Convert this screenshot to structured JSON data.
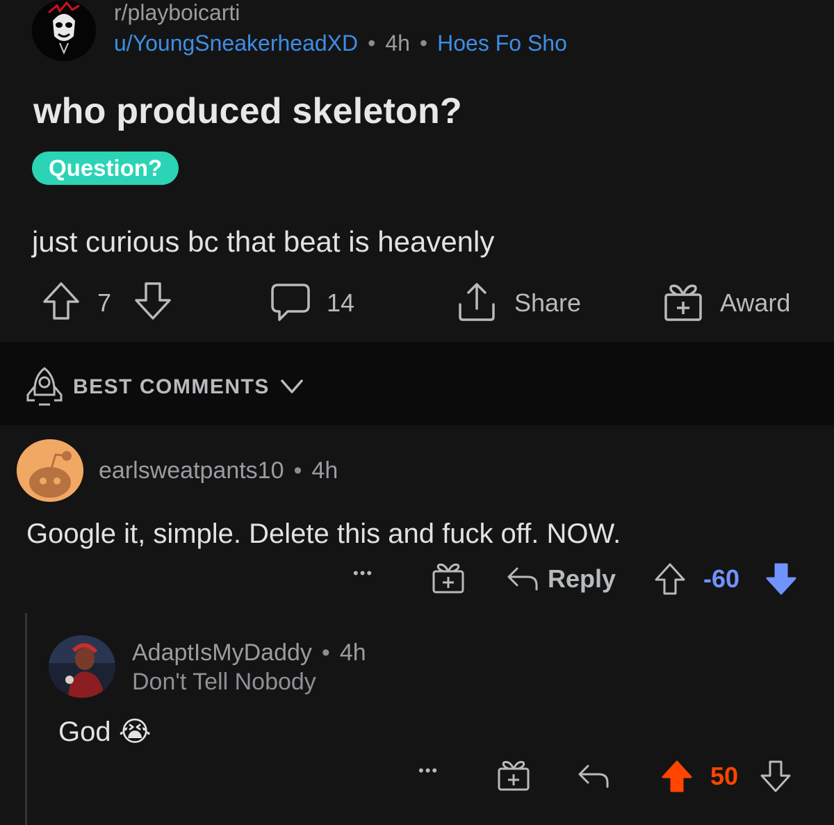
{
  "post": {
    "subreddit": "r/playboicarti",
    "author": "u/YoungSneakerheadXD",
    "separator": "•",
    "age": "4h",
    "author_flair": "Hoes Fo Sho",
    "title": "who produced skeleton?",
    "flair": "Question?",
    "body": "just curious bc that beat is heavenly",
    "score": "7",
    "comment_count": "14",
    "share_label": "Share",
    "award_label": "Award",
    "flair_color": "#2bd4b4",
    "link_color": "#3d8ee6"
  },
  "sort": {
    "label": "BEST COMMENTS",
    "icon": "rocket-icon"
  },
  "comments": [
    {
      "author": "earlsweatpants10",
      "separator": "•",
      "age": "4h",
      "body": "Google it, simple. Delete this and fuck off. NOW.",
      "more_label": "•••",
      "reply_label": "Reply",
      "score": "-60",
      "vote_state": "downvoted",
      "score_color": "#7193ff"
    },
    {
      "author": "AdaptIsMyDaddy",
      "separator": "•",
      "age": "4h",
      "flair": "Don't Tell Nobody",
      "body": "God",
      "emoji": "😭",
      "more_label": "•••",
      "score": "50",
      "vote_state": "upvoted",
      "score_color": "#ff4500"
    }
  ]
}
